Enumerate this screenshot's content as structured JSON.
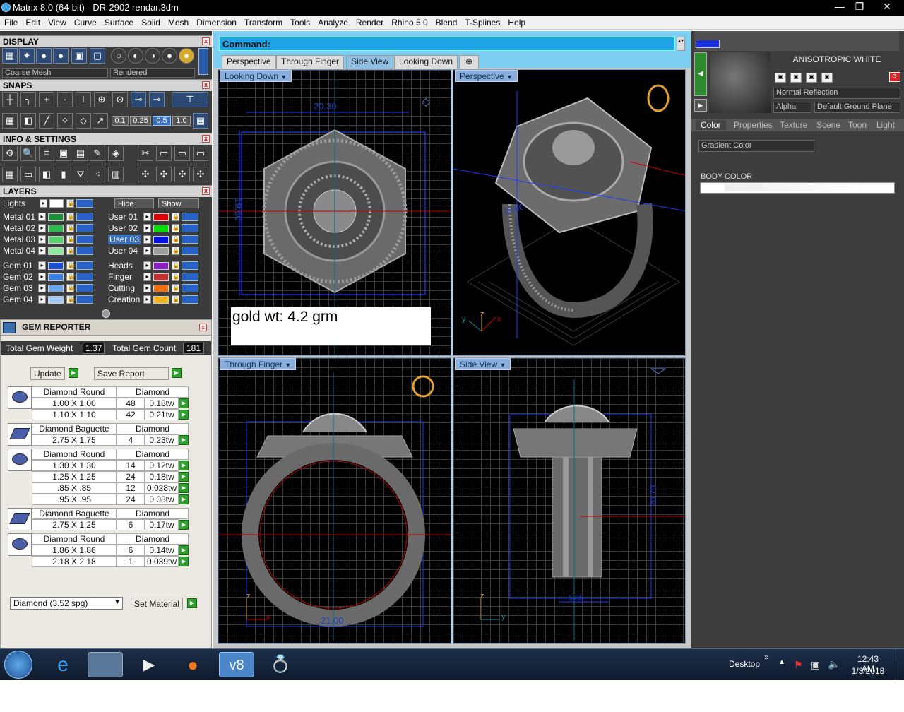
{
  "window": {
    "title": "Matrix 8.0 (64-bit) - DR-2902  rendar.3dm",
    "min": "—",
    "max": "❐",
    "close": "✕"
  },
  "menu": [
    "File",
    "Edit",
    "View",
    "Curve",
    "Surface",
    "Solid",
    "Mesh",
    "Dimension",
    "Transform",
    "Tools",
    "Analyze",
    "Render",
    "Rhino 5.0",
    "Blend",
    "T-Splines",
    "Help"
  ],
  "display": {
    "title": "DISPLAY",
    "mesh_select": "Coarse Mesh",
    "render_select": "Rendered"
  },
  "snaps": {
    "title": "SNAPS",
    "values": [
      "0.1",
      "0.25",
      "0.5",
      "1.0"
    ]
  },
  "info": {
    "title": "INFO & SETTINGS"
  },
  "layers": {
    "title": "LAYERS",
    "lights": "Lights",
    "hide": "Hide",
    "show": "Show",
    "left": [
      {
        "name": "Metal 01",
        "color": "#1a8f3a"
      },
      {
        "name": "Metal 02",
        "color": "#2fb84f"
      },
      {
        "name": "Metal 03",
        "color": "#58d070"
      },
      {
        "name": "Metal 04",
        "color": "#8fe89f"
      },
      {
        "name": "Gem 01",
        "color": "#1a4fd0"
      },
      {
        "name": "Gem 02",
        "color": "#3a7fe0"
      },
      {
        "name": "Gem 03",
        "color": "#6aa7ec"
      },
      {
        "name": "Gem 04",
        "color": "#a4c8f4"
      }
    ],
    "right": [
      {
        "name": "User 01",
        "color": "#e00000"
      },
      {
        "name": "User 02",
        "color": "#00e000"
      },
      {
        "name": "User 03",
        "color": "#0010e0"
      },
      {
        "name": "User 04",
        "color": "#9c9c9c"
      },
      {
        "name": "Heads",
        "color": "#8a20c0"
      },
      {
        "name": "Finger",
        "color": "#c03030"
      },
      {
        "name": "Cutting",
        "color": "#f07010"
      },
      {
        "name": "Creation",
        "color": "#f0b020"
      }
    ]
  },
  "gem_reporter": {
    "title": "GEM REPORTER",
    "total_weight_label": "Total Gem Weight",
    "total_weight": "1.37",
    "total_count_label": "Total Gem Count",
    "total_count": "181",
    "update": "Update",
    "save_report": "Save Report",
    "groups": [
      {
        "shape": "Diamond Round",
        "type": "Diamond",
        "icon": "round-gem-icon",
        "rows": [
          [
            "1.00 X 1.00",
            "48",
            "0.18tw"
          ],
          [
            "1.10 X 1.10",
            "42",
            "0.21tw"
          ]
        ]
      },
      {
        "shape": "Diamond Baguette",
        "type": "Diamond",
        "icon": "baguette-gem-icon",
        "rows": [
          [
            "2.75 X 1.75",
            "4",
            "0.23tw"
          ]
        ]
      },
      {
        "shape": "Diamond Round",
        "type": "Diamond",
        "icon": "round-gem-icon",
        "rows": [
          [
            "1.30 X 1.30",
            "14",
            "0.12tw"
          ],
          [
            "1.25 X 1.25",
            "24",
            "0.18tw"
          ],
          [
            ".85 X .85",
            "12",
            "0.028tw"
          ],
          [
            ".95 X .95",
            "24",
            "0.08tw"
          ]
        ]
      },
      {
        "shape": "Diamond Baguette",
        "type": "Diamond",
        "icon": "baguette-gem-icon",
        "rows": [
          [
            "2.75 X 1.25",
            "6",
            "0.17tw"
          ]
        ]
      },
      {
        "shape": "Diamond Round",
        "type": "Diamond",
        "icon": "round-gem-icon",
        "rows": [
          [
            "1.86 X 1.86",
            "6",
            "0.14tw"
          ],
          [
            "2.18 X 2.18",
            "1",
            "0.039tw"
          ]
        ]
      }
    ],
    "material_select": "Diamond    (3.52 spg)",
    "set_material": "Set Material"
  },
  "command": {
    "label": "Command:"
  },
  "view_tabs": [
    "Perspective",
    "Through Finger",
    "Side View",
    "Looking Down"
  ],
  "active_tab": 2,
  "viewports": {
    "looking_down": {
      "label": "Looking Down",
      "dim_top": "20.30",
      "dim_side": "19.60",
      "annotation": "gold wt: 4.2 grm"
    },
    "perspective": {
      "label": "Perspective",
      "dim": "19.60"
    },
    "through_finger": {
      "label": "Through Finger",
      "dim": "21.00"
    },
    "side_view": {
      "label": "Side View",
      "dim_side": "20.70",
      "dim_bottom": "5.85"
    }
  },
  "axes": {
    "x": "x",
    "y": "y",
    "z": "z"
  },
  "right_panel": {
    "material_name": "ANISOTROPIC WHITE",
    "reflection": "Normal Reflection",
    "alpha": "Alpha",
    "ground": "Default Ground Plane",
    "tabs": [
      "Color",
      "Properties",
      "Texture",
      "Scene",
      "Toon",
      "Light"
    ],
    "gradient": "Gradient Color",
    "body_color": "BODY COLOR"
  },
  "taskbar": {
    "desktop": "Desktop",
    "time": "12:43 AM",
    "date": "1/3/2018",
    "chevron": "»"
  }
}
